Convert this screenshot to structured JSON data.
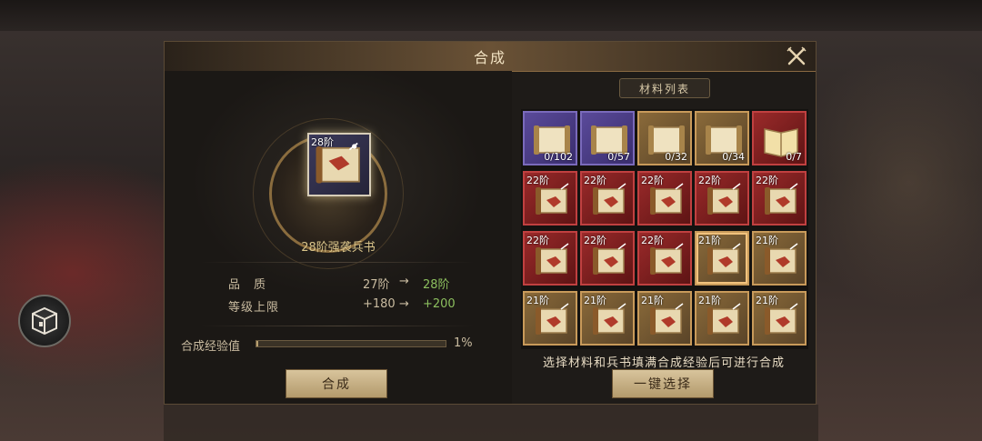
{
  "dialog": {
    "title": "合成",
    "close_icon": "close-x-icon"
  },
  "result": {
    "tier_badge": "28阶",
    "name": "28阶强袭兵书",
    "icon": "scroll-icon"
  },
  "stats": [
    {
      "label": "品　质",
      "from": "27阶",
      "arrow": "→",
      "to": "28阶"
    },
    {
      "label": "等级上限",
      "from": "+180",
      "arrow": "→",
      "to": "+200"
    }
  ],
  "experience": {
    "label": "合成经验值",
    "percent_text": "1%",
    "progress": 0.01
  },
  "buttons": {
    "synthesize": "合成",
    "auto_select": "一键选择"
  },
  "materials": {
    "header": "材料列表",
    "hint": "选择材料和兵书填满合成经验后可进行合成",
    "items": [
      {
        "tier": "",
        "count": "0/102",
        "rarity": "purple",
        "icon": "scroll-icon"
      },
      {
        "tier": "",
        "count": "0/57",
        "rarity": "purple",
        "icon": "scroll-icon"
      },
      {
        "tier": "",
        "count": "0/32",
        "rarity": "gold",
        "icon": "scroll-icon"
      },
      {
        "tier": "",
        "count": "0/34",
        "rarity": "gold",
        "icon": "scroll-icon"
      },
      {
        "tier": "",
        "count": "0/7",
        "rarity": "red",
        "icon": "book-icon"
      },
      {
        "tier": "22阶",
        "count": "",
        "rarity": "red",
        "icon": "war-scroll-icon"
      },
      {
        "tier": "22阶",
        "count": "",
        "rarity": "red",
        "icon": "war-scroll-icon"
      },
      {
        "tier": "22阶",
        "count": "",
        "rarity": "red",
        "icon": "war-scroll-icon"
      },
      {
        "tier": "22阶",
        "count": "",
        "rarity": "red",
        "icon": "war-scroll-icon"
      },
      {
        "tier": "22阶",
        "count": "",
        "rarity": "red",
        "icon": "war-scroll-icon"
      },
      {
        "tier": "22阶",
        "count": "",
        "rarity": "red",
        "icon": "war-scroll-icon"
      },
      {
        "tier": "22阶",
        "count": "",
        "rarity": "red",
        "icon": "war-scroll-icon"
      },
      {
        "tier": "22阶",
        "count": "",
        "rarity": "red",
        "icon": "war-scroll-icon"
      },
      {
        "tier": "21阶",
        "count": "",
        "rarity": "gold",
        "icon": "war-scroll-icon",
        "selected": true
      },
      {
        "tier": "21阶",
        "count": "",
        "rarity": "gold",
        "icon": "war-scroll-icon"
      },
      {
        "tier": "21阶",
        "count": "",
        "rarity": "gold",
        "icon": "war-scroll-icon"
      },
      {
        "tier": "21阶",
        "count": "",
        "rarity": "gold",
        "icon": "war-scroll-icon"
      },
      {
        "tier": "21阶",
        "count": "",
        "rarity": "gold",
        "icon": "war-scroll-icon"
      },
      {
        "tier": "21阶",
        "count": "",
        "rarity": "gold",
        "icon": "war-scroll-icon"
      },
      {
        "tier": "21阶",
        "count": "",
        "rarity": "gold",
        "icon": "war-scroll-icon"
      }
    ]
  },
  "side_button": {
    "icon": "equipment-box-icon"
  }
}
